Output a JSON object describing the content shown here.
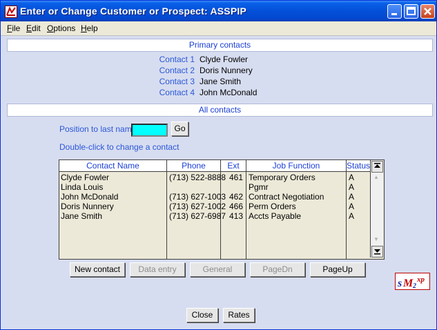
{
  "window": {
    "title": "Enter or Change Customer or Prospect: ASSPIP"
  },
  "menu": [
    {
      "label": "File",
      "mnemonic": "F",
      "rest": "ile"
    },
    {
      "label": "Edit",
      "mnemonic": "E",
      "rest": "dit"
    },
    {
      "label": "Options",
      "mnemonic": "O",
      "rest": "ptions"
    },
    {
      "label": "Help",
      "mnemonic": "H",
      "rest": "elp"
    }
  ],
  "primary": {
    "header": "Primary contacts",
    "contacts": [
      {
        "label": "Contact 1",
        "name": "Clyde Fowler"
      },
      {
        "label": "Contact 2",
        "name": "Doris Nunnery"
      },
      {
        "label": "Contact 3",
        "name": "Jane Smith"
      },
      {
        "label": "Contact 4",
        "name": "John McDonald"
      }
    ]
  },
  "all": {
    "header": "All contacts",
    "position_label": "Position to last name",
    "position_value": "",
    "go_label": "Go",
    "hint": "Double-click to change a contact"
  },
  "grid": {
    "columns": [
      "Contact Name",
      "Phone",
      "Ext",
      "Job Function",
      "Status"
    ],
    "rows": [
      {
        "name": "Clyde Fowler",
        "phone": "(713) 522-8888",
        "ext": "461",
        "job": "Temporary Orders",
        "status": "A"
      },
      {
        "name": "Linda Louis",
        "phone": "",
        "ext": "",
        "job": "Pgmr",
        "status": "A"
      },
      {
        "name": "John McDonald",
        "phone": "(713) 627-1003",
        "ext": "462",
        "job": "Contract Negotiation",
        "status": "A"
      },
      {
        "name": "Doris Nunnery",
        "phone": "(713) 627-1002",
        "ext": "466",
        "job": "Perm Orders",
        "status": "A"
      },
      {
        "name": "Jane Smith",
        "phone": "(713) 627-6987",
        "ext": "413",
        "job": "Accts Payable",
        "status": "A"
      }
    ]
  },
  "buttons": {
    "new_contact": "New contact",
    "data_entry": "Data entry",
    "general": "General",
    "pagedn": "PageDn",
    "pageup": "PageUp",
    "close": "Close",
    "rates": "Rates"
  },
  "logo": {
    "text": "SM2XP"
  },
  "colors": {
    "accent": "#2a57d8",
    "input_bg": "#00ffff",
    "titlebar": "#0450d8"
  }
}
